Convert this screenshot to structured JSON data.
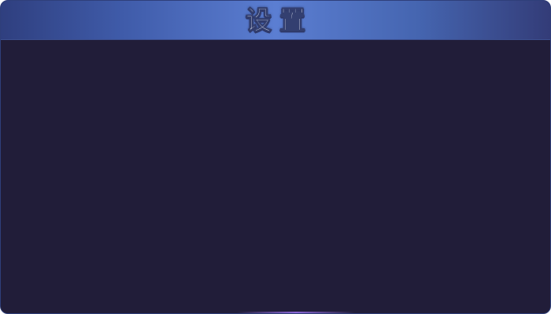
{
  "dialog": {
    "title": "设置"
  },
  "colors": {
    "header_gradient": [
      "#2f3f7f",
      "#5b7ed2",
      "#333c78"
    ],
    "body_background": "#211d39",
    "border": "#2f3f7a",
    "title_text": "#f3f5fb"
  }
}
